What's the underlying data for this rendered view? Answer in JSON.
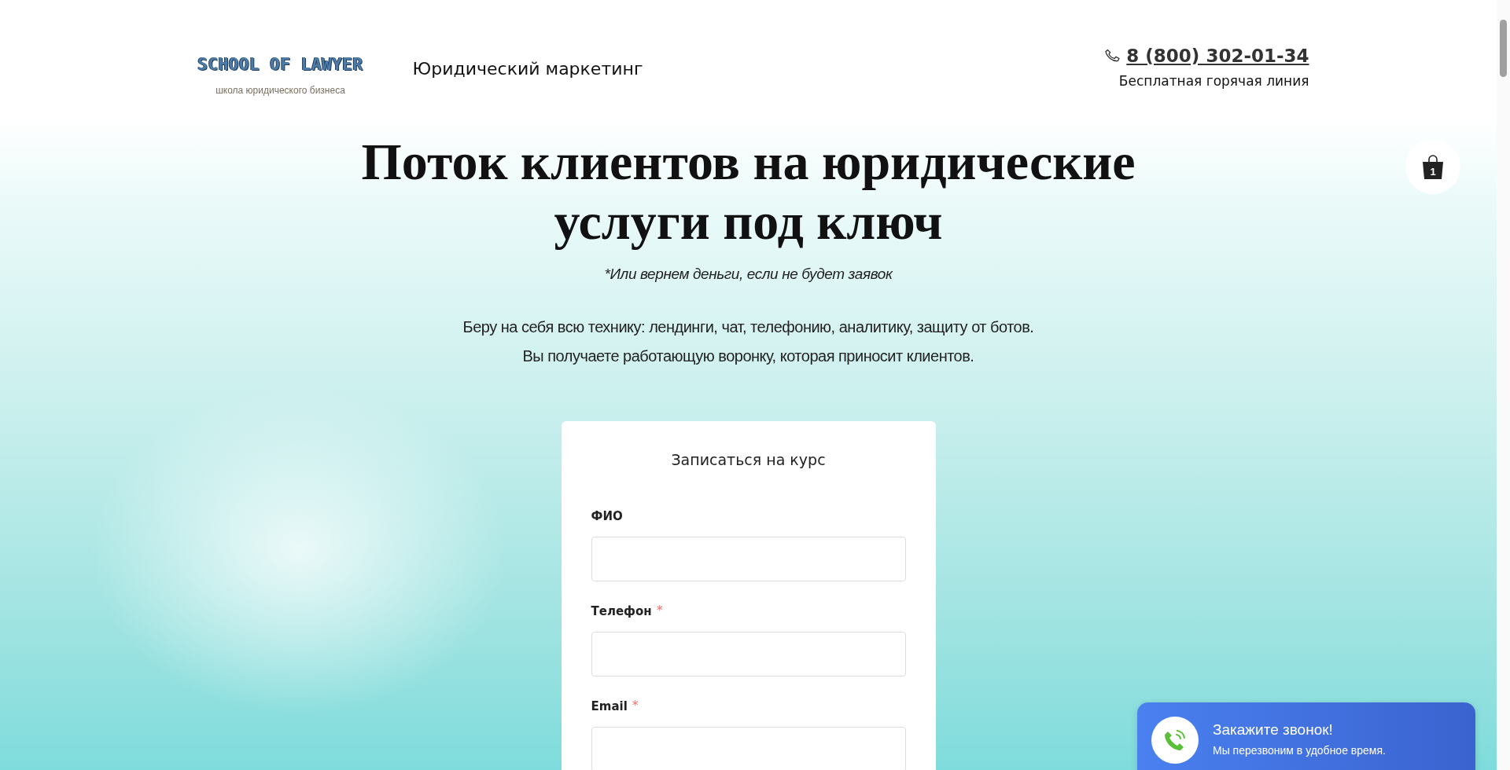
{
  "header": {
    "logo": {
      "title": "SCHOOL OF LAWYER",
      "tagline": "школа юридического бизнеса"
    },
    "site_name": "Юридический маркетинг",
    "phone": "8 (800) 302-01-34",
    "phone_caption": "Бесплатная горячая линия"
  },
  "cart": {
    "count": "1"
  },
  "hero": {
    "title_lines": [
      "Поток клиентов на юридические",
      "услуги под ключ"
    ],
    "subtitle": "*Или вернем деньги, если не будет заявок",
    "description_lines": [
      "Беру на себя всю технику: лендинги, чат, телефонию, аналитику, защиту от ботов.",
      "Вы получаете работающую воронку, которая приносит клиентов."
    ]
  },
  "form": {
    "title": "Записаться на курс",
    "fields": [
      {
        "label": "ФИО"
      },
      {
        "label": "Телефон",
        "required_mark": "*"
      },
      {
        "label": "Email",
        "required_mark": "*"
      }
    ]
  },
  "callback_widget": {
    "title": "Закажите звонок!",
    "text": "Мы перезвоним в удобное время."
  }
}
